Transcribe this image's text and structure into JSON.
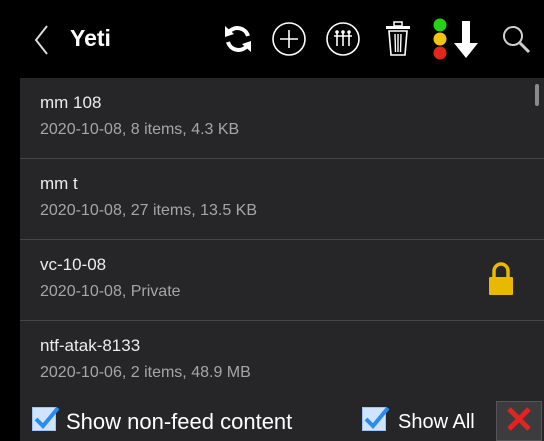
{
  "header": {
    "title": "Yeti"
  },
  "icons": {
    "back": "chevron-left-icon",
    "sync": "sync-icon",
    "add": "add-circle-icon",
    "network": "network-icon",
    "delete": "trash-icon",
    "status": "traffic-light-icon",
    "download": "download-arrow-icon",
    "search": "search-icon",
    "lock": "lock-icon",
    "close": "close-icon"
  },
  "colors": {
    "lock": "#e8b900",
    "traffic_green": "#27d118",
    "traffic_yellow": "#f1c40f",
    "traffic_red": "#e0271a",
    "close": "#e32222",
    "check": "#2a8cf0"
  },
  "items": [
    {
      "name": "mm 108",
      "meta": "2020-10-08, 8 items, 4.3 KB",
      "locked": false
    },
    {
      "name": "mm t",
      "meta": "2020-10-08, 27 items, 13.5 KB",
      "locked": false
    },
    {
      "name": "vc-10-08",
      "meta": "2020-10-08, Private",
      "locked": true
    },
    {
      "name": "ntf-atak-8133",
      "meta": "2020-10-06, 2 items, 48.9 MB",
      "locked": false
    }
  ],
  "footer": {
    "show_non_feed_label": "Show non-feed content",
    "show_non_feed_checked": true,
    "show_all_label": "Show All",
    "show_all_checked": true
  }
}
